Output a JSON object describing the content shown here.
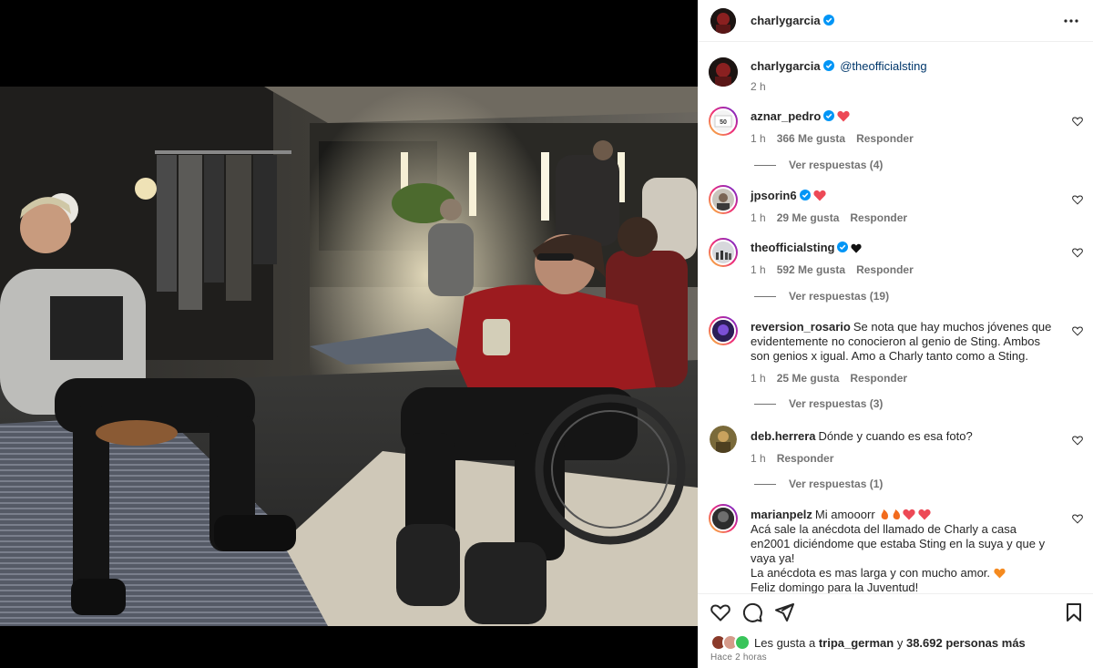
{
  "post": {
    "author": "charlygarcia",
    "caption_author": "charlygarcia",
    "caption_mention": "@theofficialsting",
    "caption_time": "2 h"
  },
  "comments": [
    {
      "user": "aznar_pedro",
      "text": "",
      "heart": "red",
      "time": "1 h",
      "likes": "366 Me gusta",
      "reply": "Responder",
      "view_replies": "Ver respuestas (4)",
      "verified": true,
      "avatar_label": "50"
    },
    {
      "user": "jpsorin6",
      "text": "",
      "heart": "red",
      "time": "1 h",
      "likes": "29 Me gusta",
      "reply": "Responder",
      "view_replies": "",
      "verified": true
    },
    {
      "user": "theofficialsting",
      "text": "",
      "heart": "black",
      "time": "1 h",
      "likes": "592 Me gusta",
      "reply": "Responder",
      "view_replies": "Ver respuestas (19)",
      "verified": true
    },
    {
      "user": "reversion_rosario",
      "text": "Se nota que hay muchos jóvenes que evidentemente no conocieron al genio de Sting. Ambos son genios x igual. Amo a Charly tanto como a Sting.",
      "time": "1 h",
      "likes": "25 Me gusta",
      "reply": "Responder",
      "view_replies": "Ver respuestas (3)",
      "verified": false
    },
    {
      "user": "deb.herrera",
      "text": "Dónde y cuando es esa foto?",
      "time": "1 h",
      "likes": "",
      "reply": "Responder",
      "view_replies": "Ver respuestas (1)",
      "verified": false
    },
    {
      "user": "marianpelz",
      "text": "Mi amooorr",
      "lines": [
        "Acá sale la anécdota del llamado de Charly a casa en2001 diciéndome que estaba Sting en la suya y que y vaya ya!",
        "La anécdota es mas larga y con mucho amor.",
        "Feliz domingo para la Juventud!"
      ],
      "time": "",
      "likes": "",
      "reply": "",
      "view_replies": "",
      "verified": false
    }
  ],
  "footer": {
    "likes_prefix": "Les gusta a",
    "likes_user": "tripa_german",
    "likes_conj": "y",
    "likes_others": "38.692 personas más",
    "timestamp": "Hace 2 horas"
  },
  "colors": {
    "verified_blue": "#0095f6",
    "heart_red": "#ed4956",
    "text_primary": "#262626",
    "text_secondary": "#737373",
    "link_blue": "#00376b"
  },
  "icons": [
    "more-icon",
    "heart-icon",
    "comment-icon",
    "share-icon",
    "bookmark-icon",
    "verified-icon"
  ]
}
